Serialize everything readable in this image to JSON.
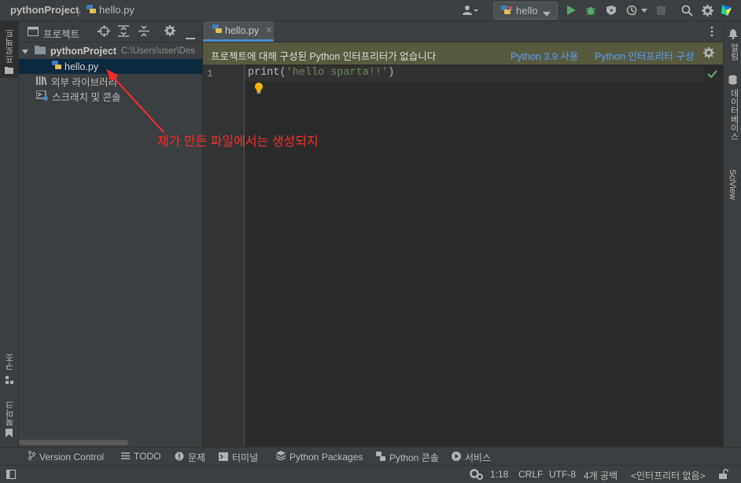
{
  "navbar": {
    "project": "pythonProject",
    "file": "hello.py",
    "run_config": "hello"
  },
  "left_stripe": {
    "project_tab": "프로젝트",
    "structure_tab": "구조",
    "bookmarks_tab": "북마크"
  },
  "project_panel": {
    "title": "프로젝트",
    "tree": {
      "root_name": "pythonProject",
      "root_path": "C:\\Users\\user\\Des",
      "file": "hello.py",
      "ext_libs": "외부 라이브러리",
      "scratches": "스크래치 및 콘솔"
    }
  },
  "editor": {
    "tab": "hello.py",
    "banner": {
      "message": "프로젝트에 대해 구성된 Python 인터프리터가 없습니다",
      "use_link": "Python 3.9 사용",
      "config_link": "Python 인터프리터 구성"
    },
    "line_number": "1",
    "code": {
      "func": "print(",
      "string": "'hello sparta!!'",
      "close": ")"
    }
  },
  "right_stripe": {
    "notifications": "알림",
    "database": "데이터베이스",
    "sciview": "SciView"
  },
  "bottom_tools": {
    "vcs": "Version Control",
    "todo": "TODO",
    "problems": "문제",
    "terminal": "터미널",
    "packages": "Python Packages",
    "console": "Python 콘솔",
    "services": "서비스"
  },
  "status": {
    "position": "1:18",
    "line_sep": "CRLF",
    "encoding": "UTF-8",
    "indent": "4개 공백",
    "interpreter": "<인터프리터 없음>"
  },
  "annotation": {
    "text": "제가 만든 파일에서는 생성되지"
  },
  "colors": {
    "accent": "#4a88c7",
    "run_green": "#59a869",
    "annotation_red": "#ff2a2a",
    "banner_bg": "#585a3f"
  }
}
